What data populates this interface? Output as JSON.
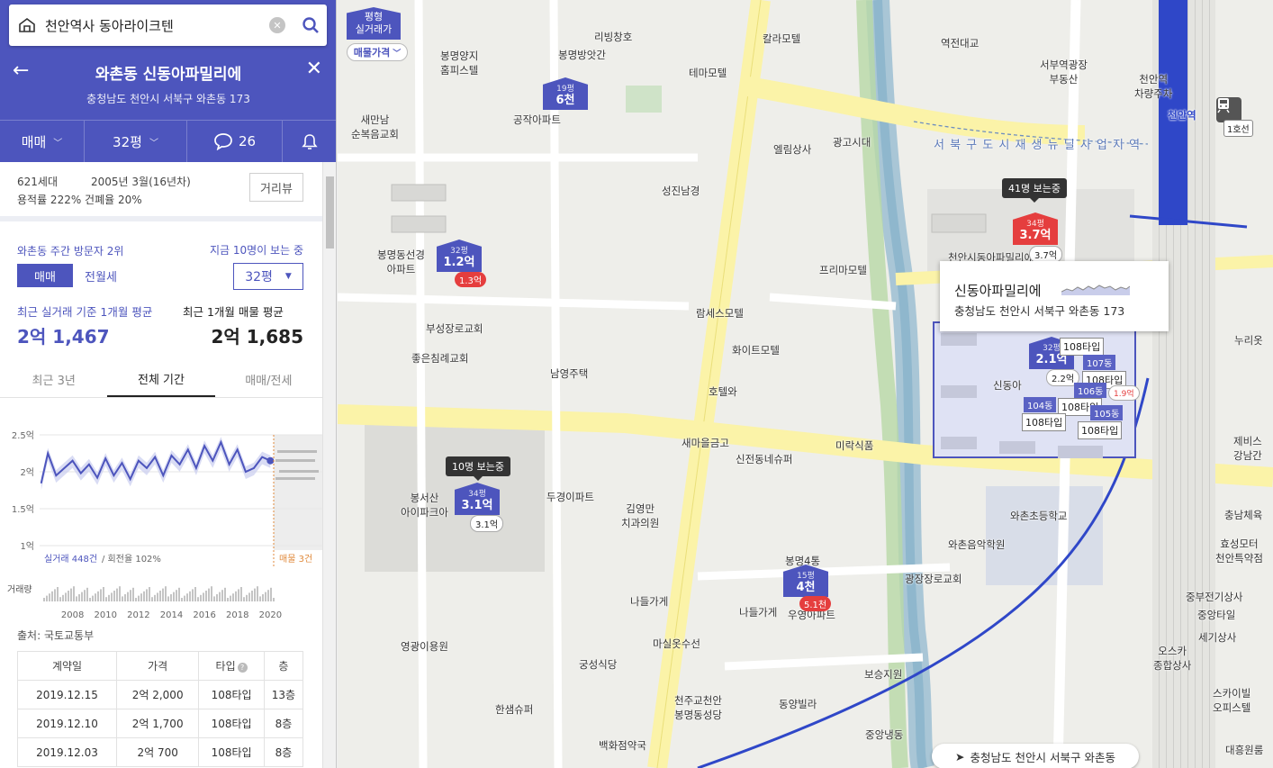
{
  "search": {
    "query": "천안역사 동아라이크텐"
  },
  "header": {
    "name": "와촌동 신동아파밀리에",
    "address": "충청남도 천안시 서북구 와촌동 173"
  },
  "tabs": {
    "trade": "매매",
    "size": "32평",
    "comments": "26"
  },
  "info": {
    "households": "621세대",
    "built": "2005년 3월(16년차)",
    "ratio": "용적률 222% 건폐율 20%",
    "street_view": "거리뷰"
  },
  "price": {
    "visitor_rank": "와촌동 주간 방문자 2위",
    "viewing_now": "지금 10명이 보는 중",
    "seg_on": "매매",
    "seg_off": "전월세",
    "size": "32평",
    "avg_label_1": "최근 실거래 기준 1개월 평균",
    "avg_label_2": "최근 1개월 매물 평균",
    "avg_value_1": "2억 1,467",
    "avg_value_2": "2억 1,685"
  },
  "period": {
    "p1": "최근 3년",
    "p2": "전체 기간",
    "p3": "매매/전세"
  },
  "chart_labels": {
    "volume_label": "거래량",
    "deals_note_1": "실거래 448건",
    "deals_note_2": " / 회전율 102%",
    "listing_note": "매물 3건"
  },
  "chart_data": {
    "type": "line",
    "title": "",
    "ylabel": "",
    "y_ticks": [
      "2.5억",
      "2억",
      "1.5억",
      "1억"
    ],
    "ylim": [
      1.0,
      2.5
    ],
    "x_ticks": [
      "2008",
      "2010",
      "2012",
      "2014",
      "2016",
      "2018",
      "2020"
    ],
    "xlim": [
      2006.0,
      2020.2
    ],
    "series": [
      {
        "name": "",
        "x": [
          2006.1,
          2006.5,
          2007.0,
          2007.5,
          2008.0,
          2008.5,
          2009.0,
          2009.5,
          2010.0,
          2010.5,
          2011.0,
          2011.5,
          2012.0,
          2012.5,
          2013.0,
          2013.5,
          2014.0,
          2014.5,
          2015.0,
          2015.5,
          2016.0,
          2016.5,
          2017.0,
          2017.5,
          2018.0,
          2018.5,
          2019.0,
          2019.5,
          2020.0
        ],
        "values": [
          1.85,
          2.25,
          1.95,
          2.05,
          2.15,
          1.98,
          2.1,
          1.92,
          2.18,
          1.95,
          2.12,
          1.9,
          2.15,
          2.05,
          2.2,
          1.95,
          2.22,
          2.1,
          2.3,
          2.05,
          2.35,
          2.15,
          2.4,
          2.1,
          2.3,
          2.0,
          2.05,
          2.2,
          2.15
        ]
      }
    ]
  },
  "source": "출처: 국토교통부",
  "deals_table": {
    "headers": [
      "계약일",
      "가격",
      "타입",
      "층"
    ],
    "rows": [
      [
        "2019.12.15",
        "2억 2,000",
        "108타입",
        "13층"
      ],
      [
        "2019.12.10",
        "2억 1,700",
        "108타입",
        "8층"
      ],
      [
        "2019.12.03",
        "2억 700",
        "108타입",
        "8층"
      ]
    ]
  },
  "map": {
    "price_btn_top": "평형\n실거래가",
    "price_btn_bottom": "매물가격",
    "popup_name": "신동아파밀리에",
    "popup_addr": "충청남도 천안시 서북구 와촌동 173",
    "location": "충청남도 천안시 서북구 와촌동",
    "rail_label": "1호선",
    "zone_label": "서 북 구 도 시 재 생 뉴 딜 사 업 지 역",
    "markers": [
      {
        "py": "19평",
        "pr": "6천"
      },
      {
        "py": "32평",
        "pr": "1.2억",
        "chip": "1.3억"
      },
      {
        "py": "34평",
        "pr": "3.1억",
        "chip": "3.1억",
        "tip": "10명 보는중"
      },
      {
        "py": "15평",
        "pr": "4천",
        "chip": "5.1천"
      },
      {
        "py": "34평",
        "pr": "3.7억",
        "chip": "3.7억",
        "tip": "41명 보는중"
      },
      {
        "py": "32평",
        "pr": "2.1억",
        "chip": "2.2억"
      }
    ],
    "type_labels": [
      "108타입",
      "108타입",
      "108타입",
      "108타입",
      "108타입"
    ],
    "chip_19": "1.9억",
    "bldgs": [
      "107동",
      "106동",
      "104동",
      "105동"
    ],
    "labels": [
      "리빙창호",
      "칼라모텔",
      "역전대교",
      "봉명양지\n홈피스텔",
      "봉명방앗간",
      "테마모텔",
      "서부역광장\n부동산",
      "천안역\n차량주차",
      "새만남\n순복음교회",
      "공작아파트",
      "엘림상사",
      "광고시대",
      "성진남경",
      "천안역",
      "봉명동선경\n아파트",
      "프리마모텔",
      "람세스모텔",
      "부성장로교회",
      "좋은침례교회",
      "화이트모텔",
      "남영주택",
      "호텔와",
      "새마을금고",
      "미락식품",
      "신전동네슈퍼",
      "봉서산\n아이파크아",
      "두경이파트",
      "김영만\n치과의원",
      "와촌초등학교",
      "와촌음악학원",
      "광장장로교회",
      "봉명4통",
      "나들가게",
      "나들가게",
      "우영아파트",
      "마실옷수선",
      "영광이용원",
      "궁성식당",
      "천주교천안\n봉명동성당",
      "동양빌라",
      "보승지원",
      "한샘슈퍼",
      "중앙냉동",
      "백화점약국",
      "누리옷",
      "제비스\n강남간",
      "충남체육",
      "효성모터\n천안특약점",
      "중부전기상사",
      "중앙타일",
      "세기상사",
      "오스카\n종합상사",
      "스카이빌\n오피스텔",
      "대흥원룸",
      "신동아",
      "천안시동아파밀리에"
    ]
  }
}
